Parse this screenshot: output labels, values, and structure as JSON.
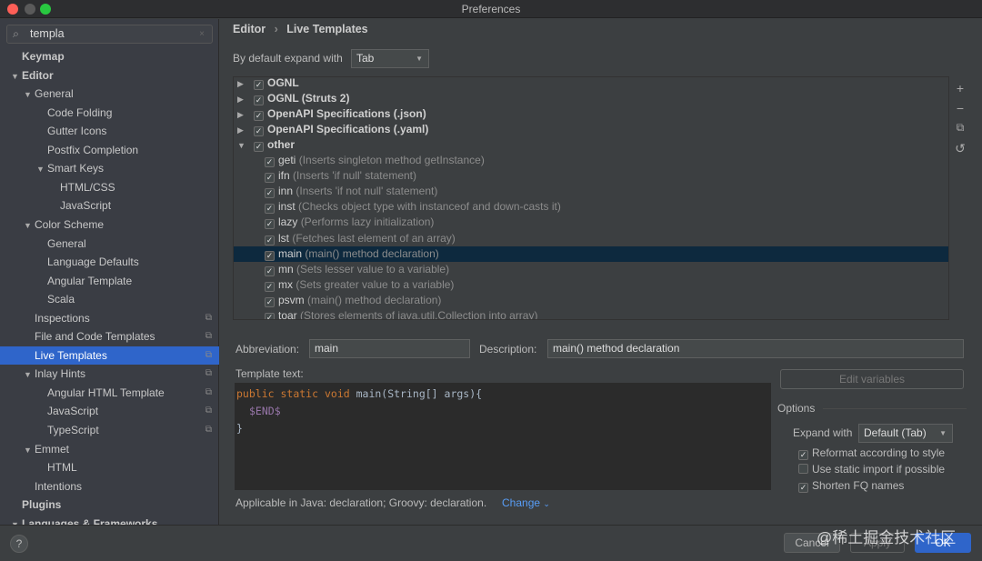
{
  "window": {
    "title": "Preferences"
  },
  "search": {
    "value": "templa"
  },
  "sidebar": {
    "items": [
      {
        "label": "Keymap",
        "level": 0,
        "bold": true
      },
      {
        "label": "Editor",
        "level": 0,
        "bold": true,
        "expanded": true
      },
      {
        "label": "General",
        "level": 1,
        "expanded": true
      },
      {
        "label": "Code Folding",
        "level": 2
      },
      {
        "label": "Gutter Icons",
        "level": 2
      },
      {
        "label": "Postfix Completion",
        "level": 2
      },
      {
        "label": "Smart Keys",
        "level": 2,
        "expanded": true
      },
      {
        "label": "HTML/CSS",
        "level": 3
      },
      {
        "label": "JavaScript",
        "level": 3
      },
      {
        "label": "Color Scheme",
        "level": 1,
        "expanded": true
      },
      {
        "label": "General",
        "level": 2
      },
      {
        "label": "Language Defaults",
        "level": 2
      },
      {
        "label": "Angular Template",
        "level": 2
      },
      {
        "label": "Scala",
        "level": 2
      },
      {
        "label": "Inspections",
        "level": 1,
        "copy": true
      },
      {
        "label": "File and Code Templates",
        "level": 1,
        "copy": true
      },
      {
        "label": "Live Templates",
        "level": 1,
        "selected": true,
        "copy": true
      },
      {
        "label": "Inlay Hints",
        "level": 1,
        "expanded": true,
        "copy": true
      },
      {
        "label": "Angular HTML Template",
        "level": 2,
        "copy": true
      },
      {
        "label": "JavaScript",
        "level": 2,
        "copy": true
      },
      {
        "label": "TypeScript",
        "level": 2,
        "copy": true
      },
      {
        "label": "Emmet",
        "level": 1,
        "expanded": true
      },
      {
        "label": "HTML",
        "level": 2
      },
      {
        "label": "Intentions",
        "level": 1
      },
      {
        "label": "Plugins",
        "level": 0,
        "bold": true
      },
      {
        "label": "Languages & Frameworks",
        "level": 0,
        "bold": true,
        "expanded": true
      }
    ]
  },
  "breadcrumb": {
    "parent": "Editor",
    "current": "Live Templates"
  },
  "expand_default": {
    "label": "By default expand with",
    "value": "Tab"
  },
  "templates": [
    {
      "type": "group",
      "name": "OGNL",
      "checked": true,
      "expanded": false
    },
    {
      "type": "group",
      "name": "OGNL (Struts 2)",
      "checked": true,
      "expanded": false
    },
    {
      "type": "group",
      "name": "OpenAPI Specifications (.json)",
      "checked": true,
      "expanded": false
    },
    {
      "type": "group",
      "name": "OpenAPI Specifications (.yaml)",
      "checked": true,
      "expanded": false
    },
    {
      "type": "group",
      "name": "other",
      "checked": true,
      "expanded": true
    },
    {
      "type": "item",
      "name": "geti",
      "desc": "(Inserts singleton method getInstance)",
      "checked": true
    },
    {
      "type": "item",
      "name": "ifn",
      "desc": "(Inserts 'if null' statement)",
      "checked": true
    },
    {
      "type": "item",
      "name": "inn",
      "desc": "(Inserts 'if not null' statement)",
      "checked": true
    },
    {
      "type": "item",
      "name": "inst",
      "desc": "(Checks object type with instanceof and down-casts it)",
      "checked": true
    },
    {
      "type": "item",
      "name": "lazy",
      "desc": "(Performs lazy initialization)",
      "checked": true
    },
    {
      "type": "item",
      "name": "lst",
      "desc": "(Fetches last element of an array)",
      "checked": true
    },
    {
      "type": "item",
      "name": "main",
      "desc": "(main() method declaration)",
      "checked": true,
      "selected": true
    },
    {
      "type": "item",
      "name": "mn",
      "desc": "(Sets lesser value to a variable)",
      "checked": true
    },
    {
      "type": "item",
      "name": "mx",
      "desc": "(Sets greater value to a variable)",
      "checked": true
    },
    {
      "type": "item",
      "name": "psvm",
      "desc": "(main() method declaration)",
      "checked": true
    },
    {
      "type": "item",
      "name": "toar",
      "desc": "(Stores elements of java.util.Collection into array)",
      "checked": true
    }
  ],
  "toolbar": {
    "add": "+",
    "remove": "−",
    "copy": "⧉",
    "revert": "↺"
  },
  "form": {
    "abbreviation_label": "Abbreviation:",
    "abbreviation": "main",
    "description_label": "Description:",
    "description": "main() method declaration",
    "template_text_label": "Template text:",
    "code": {
      "kw1": "public",
      "kw2": "static",
      "kw3": "void",
      "sig": " main(String[] args){",
      "var": "$END$",
      "close": "}"
    },
    "edit_variables": "Edit variables",
    "applicable": "Applicable in Java: declaration; Groovy: declaration.",
    "change": "Change"
  },
  "options": {
    "title": "Options",
    "expand_label": "Expand with",
    "expand_value": "Default (Tab)",
    "checks": [
      {
        "label": "Reformat according to style",
        "checked": true
      },
      {
        "label": "Use static import if possible",
        "checked": false
      },
      {
        "label": "Shorten FQ names",
        "checked": true
      }
    ]
  },
  "buttons": {
    "help": "?",
    "cancel": "Cancel",
    "apply": "Apply",
    "ok": "OK"
  },
  "watermark": "@稀土掘金技术社区",
  "colors": {
    "selection": "#2f65ca",
    "row_selected": "#0d293e",
    "ok": "#2f65ca",
    "keyword": "#cc7832",
    "variable": "#9876aa",
    "link": "#589df6"
  }
}
